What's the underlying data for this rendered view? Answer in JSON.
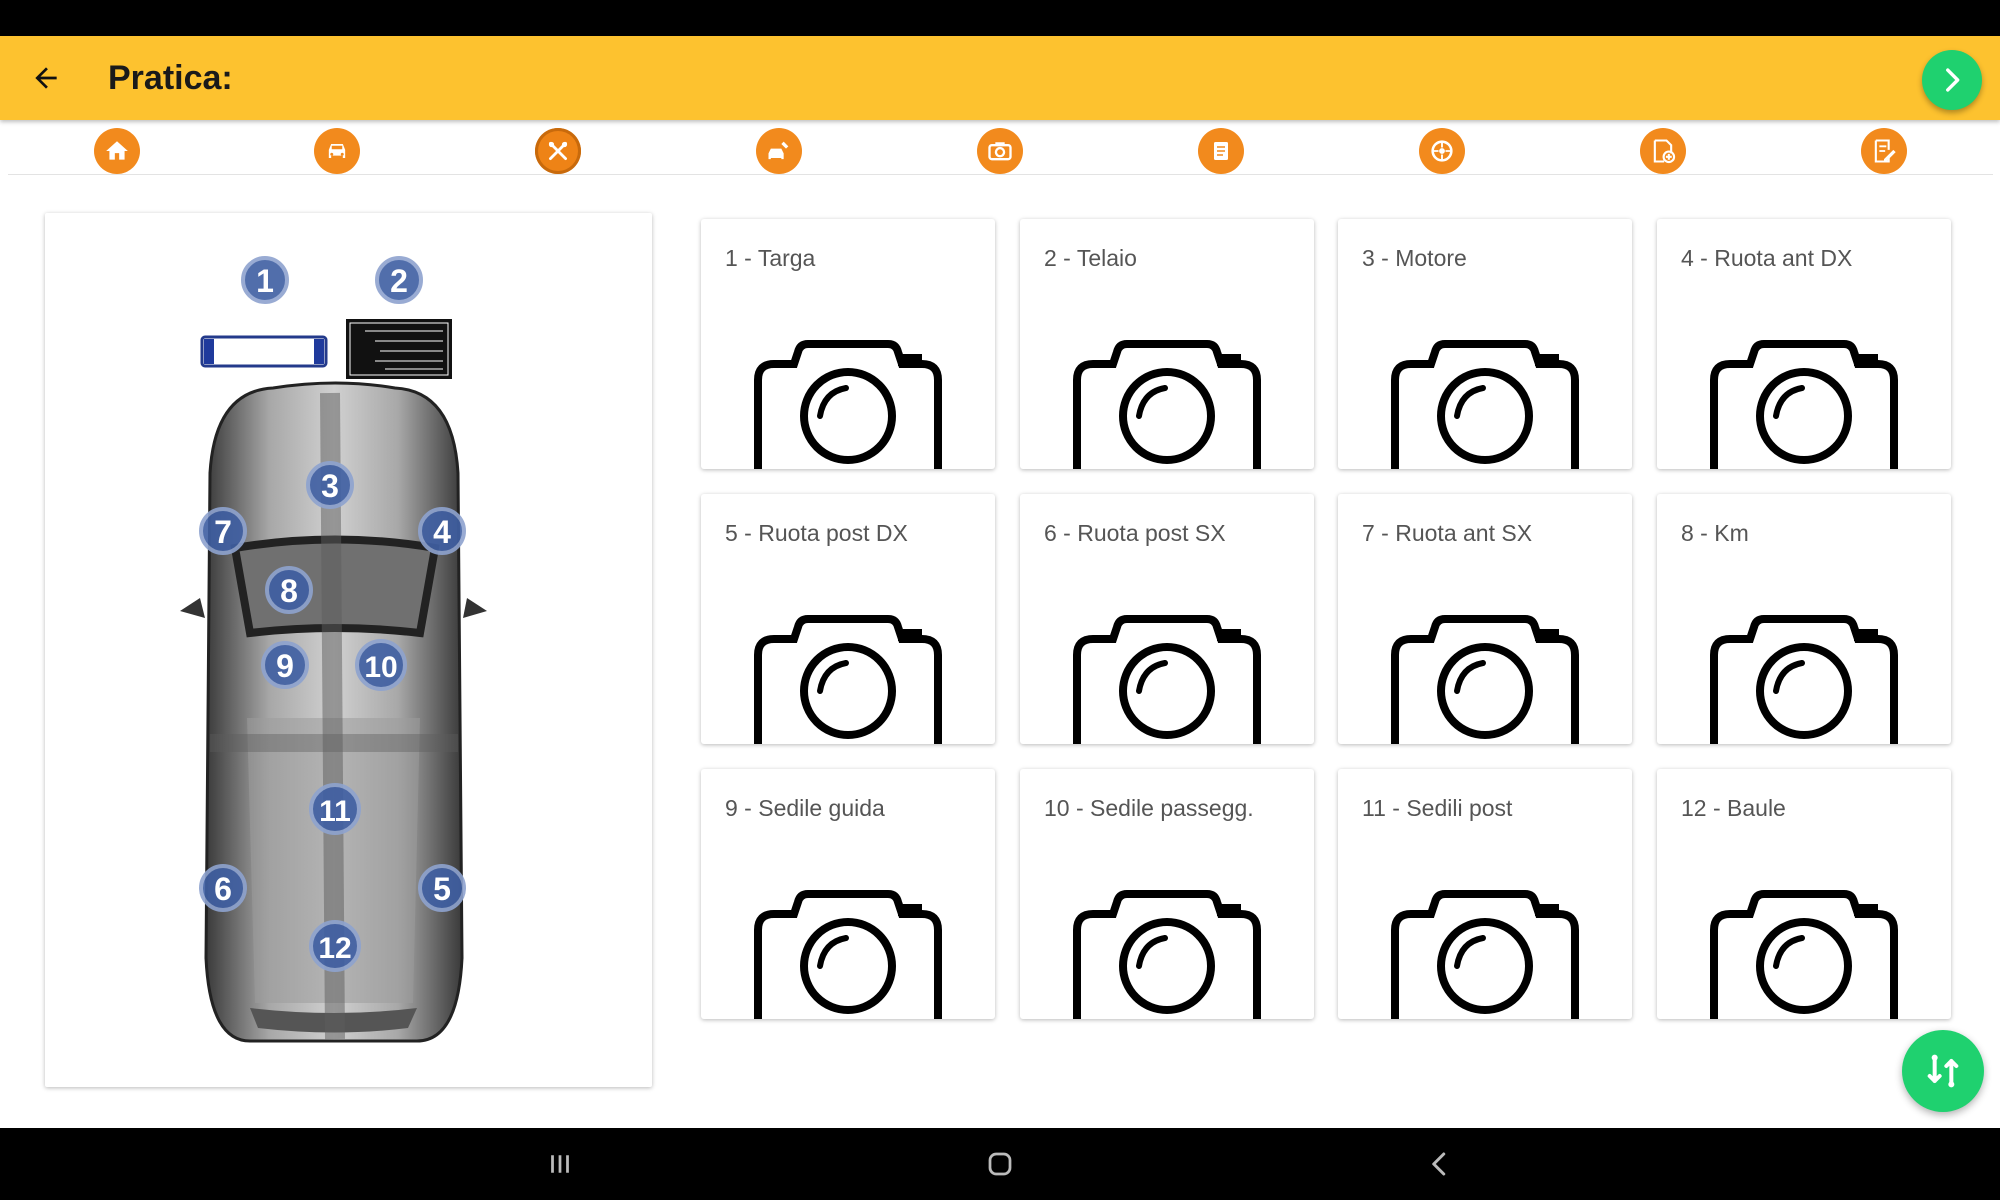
{
  "app_bar": {
    "title": "Pratica:",
    "back_icon": "arrow-left-icon",
    "next_icon": "chevron-right-icon"
  },
  "colors": {
    "app_bar": "#fdc22f",
    "nav_icon": "#f28a1d",
    "fab": "#1fd16f",
    "marker": "#3f5fa3"
  },
  "nav_icons": [
    {
      "icon": "home-icon"
    },
    {
      "icon": "car-icon"
    },
    {
      "icon": "tools-icon",
      "active": true
    },
    {
      "icon": "car-service-icon"
    },
    {
      "icon": "camera-icon"
    },
    {
      "icon": "document-icon"
    },
    {
      "icon": "wheel-icon"
    },
    {
      "icon": "document-add-icon"
    },
    {
      "icon": "document-edit-icon"
    }
  ],
  "diagram": {
    "markers": [
      "1",
      "2",
      "3",
      "4",
      "5",
      "6",
      "7",
      "8",
      "9",
      "10",
      "11",
      "12"
    ]
  },
  "photo_cards": [
    {
      "label": "1 - Targa"
    },
    {
      "label": "2 - Telaio"
    },
    {
      "label": "3 - Motore"
    },
    {
      "label": "4 - Ruota ant DX"
    },
    {
      "label": "5 - Ruota post DX"
    },
    {
      "label": "6 - Ruota post SX"
    },
    {
      "label": "7 - Ruota ant SX"
    },
    {
      "label": "8 - Km"
    },
    {
      "label": "9 - Sedile guida"
    },
    {
      "label": "10 - Sedile passegg."
    },
    {
      "label": "11 - Sedili post"
    },
    {
      "label": "12 - Baule"
    }
  ],
  "fab": {
    "icon": "swap-icon"
  },
  "system_nav": {
    "recent_icon": "recent-apps-icon",
    "home_icon": "home-button-icon",
    "back_icon": "system-back-icon"
  }
}
